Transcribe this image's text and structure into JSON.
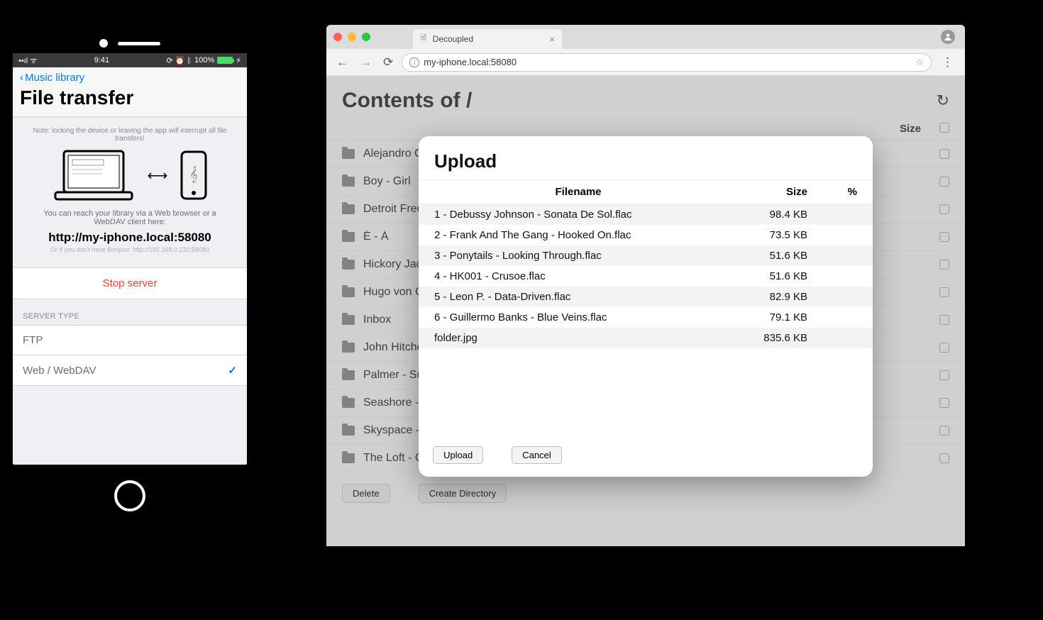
{
  "phone": {
    "status": {
      "left": "••ıl ᯤ",
      "time": "9:41",
      "right_icons": "⟳ ⏰ ᛒ",
      "battery": "100%"
    },
    "nav": {
      "back_label": "Music library",
      "title": "File transfer"
    },
    "note": "Note: locking the device or leaving the app will interrupt all file transfers!",
    "instructions": "You can reach your library via a Web browser or a WebDAV client here:",
    "url": "http://my-iphone.local:58080",
    "alt_url": "Or if you don't have Bonjour: http://192.168.0.220:58080",
    "stop_button": "Stop server",
    "server_type_header": "SERVER TYPE",
    "options": [
      {
        "label": "FTP",
        "selected": false
      },
      {
        "label": "Web / WebDAV",
        "selected": true
      }
    ]
  },
  "browser": {
    "tab_title": "Decoupled",
    "address": "my-iphone.local:58080",
    "page_title": "Contents of /",
    "headers": {
      "name": "",
      "size": "Size"
    },
    "directories": [
      "Alejandro Ca",
      "Boy - Girl",
      "Detroit Frequ",
      "É - Á",
      "Hickory Jack",
      "Hugo von Ca",
      "Inbox",
      "John Hitchen",
      "Palmer - Sur",
      "Seashore - S",
      "Skyspace - V",
      "The Loft - Collective"
    ],
    "buttons": {
      "delete": "Delete",
      "create_dir": "Create Directory"
    }
  },
  "modal": {
    "title": "Upload",
    "headers": {
      "filename": "Filename",
      "size": "Size",
      "pct": "%"
    },
    "files": [
      {
        "name": "1 - Debussy Johnson - Sonata De Sol.flac",
        "size": "98.4 KB",
        "pct": ""
      },
      {
        "name": "2 - Frank And The Gang - Hooked On.flac",
        "size": "73.5 KB",
        "pct": ""
      },
      {
        "name": "3 - Ponytails - Looking Through.flac",
        "size": "51.6 KB",
        "pct": ""
      },
      {
        "name": "4 - HK001 - Crusoe.flac",
        "size": "51.6 KB",
        "pct": ""
      },
      {
        "name": "5 - Leon P. - Data-Driven.flac",
        "size": "82.9 KB",
        "pct": ""
      },
      {
        "name": "6 - Guillermo Banks - Blue Veins.flac",
        "size": "79.1 KB",
        "pct": ""
      },
      {
        "name": "folder.jpg",
        "size": "835.6 KB",
        "pct": ""
      }
    ],
    "buttons": {
      "upload": "Upload",
      "cancel": "Cancel"
    }
  }
}
